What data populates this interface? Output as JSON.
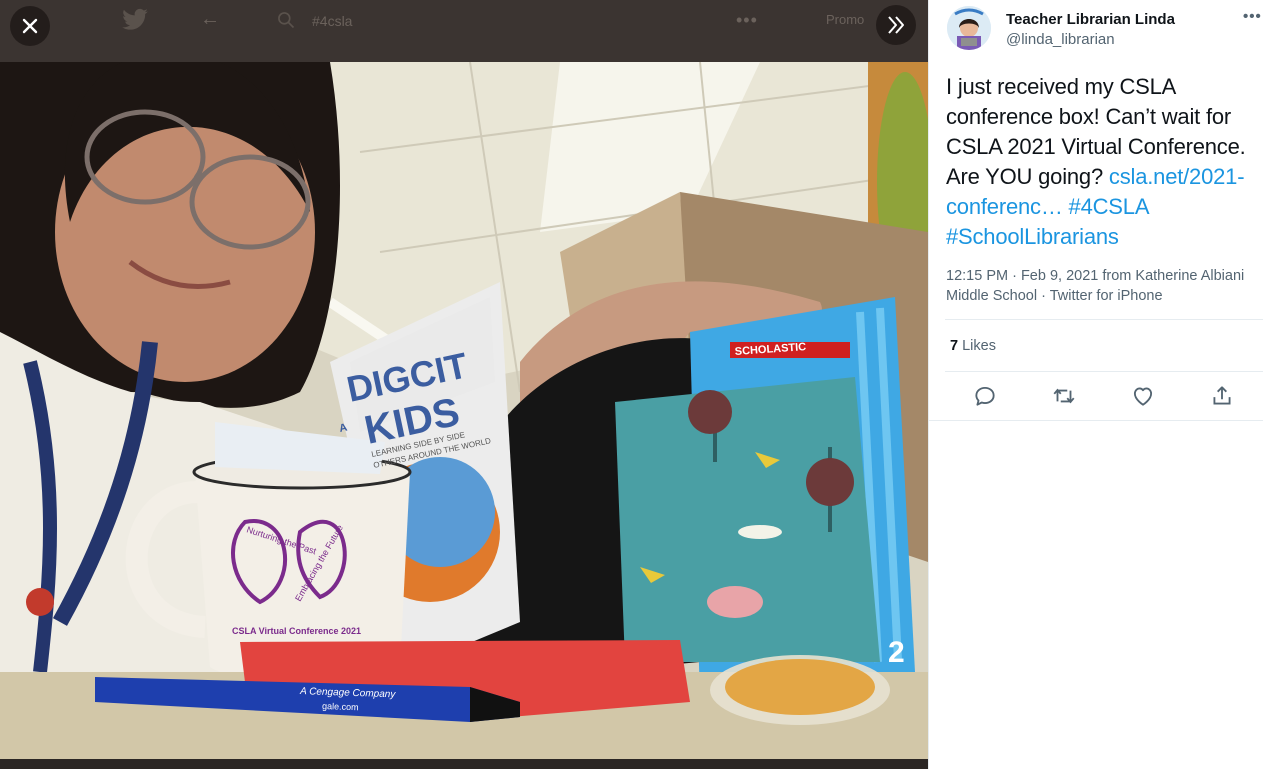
{
  "viewer": {
    "background_query": "#4csla",
    "background_promo": "Promo",
    "close_icon": "close-icon",
    "next_icon": "double-chevron-right-icon",
    "photo_text": {
      "book_line1": "DIGCIT",
      "book_line2": "KIDS",
      "book_small": "A",
      "book_subtitle1": "LEARNING SIDE BY SIDE",
      "book_subtitle2": "OTHERS AROUND THE WORLD",
      "mug_line1": "Nurturing the Past",
      "mug_line2": "Embracing the Future",
      "mug_footer": "CSLA Virtual Conference 2021",
      "scholastic": "SCHOLASTIC",
      "pen_text": "A Cengage Company",
      "pen_url": "gale.com",
      "box_number": "2"
    }
  },
  "tweet": {
    "author_name": "Teacher Librarian Linda",
    "author_handle": "@linda_librarian",
    "text_plain": "I just received my CSLA conference box!  Can’t wait for CSLA 2021 Virtual Conference. Are YOU going? ",
    "link_url": "csla.net/2021-conferenc…",
    "hashtag_1": "#4CSLA",
    "hashtag_2": "#SchoolLibrarians",
    "meta": "12:15 PM · Feb 9, 2021 from Katherine Albiani Middle School · Twitter for iPhone",
    "likes_count": "7",
    "likes_label": "Likes"
  },
  "colors": {
    "link": "#1b95e0",
    "secondary_text": "#536471",
    "viewer_bg": "#2b2624"
  }
}
